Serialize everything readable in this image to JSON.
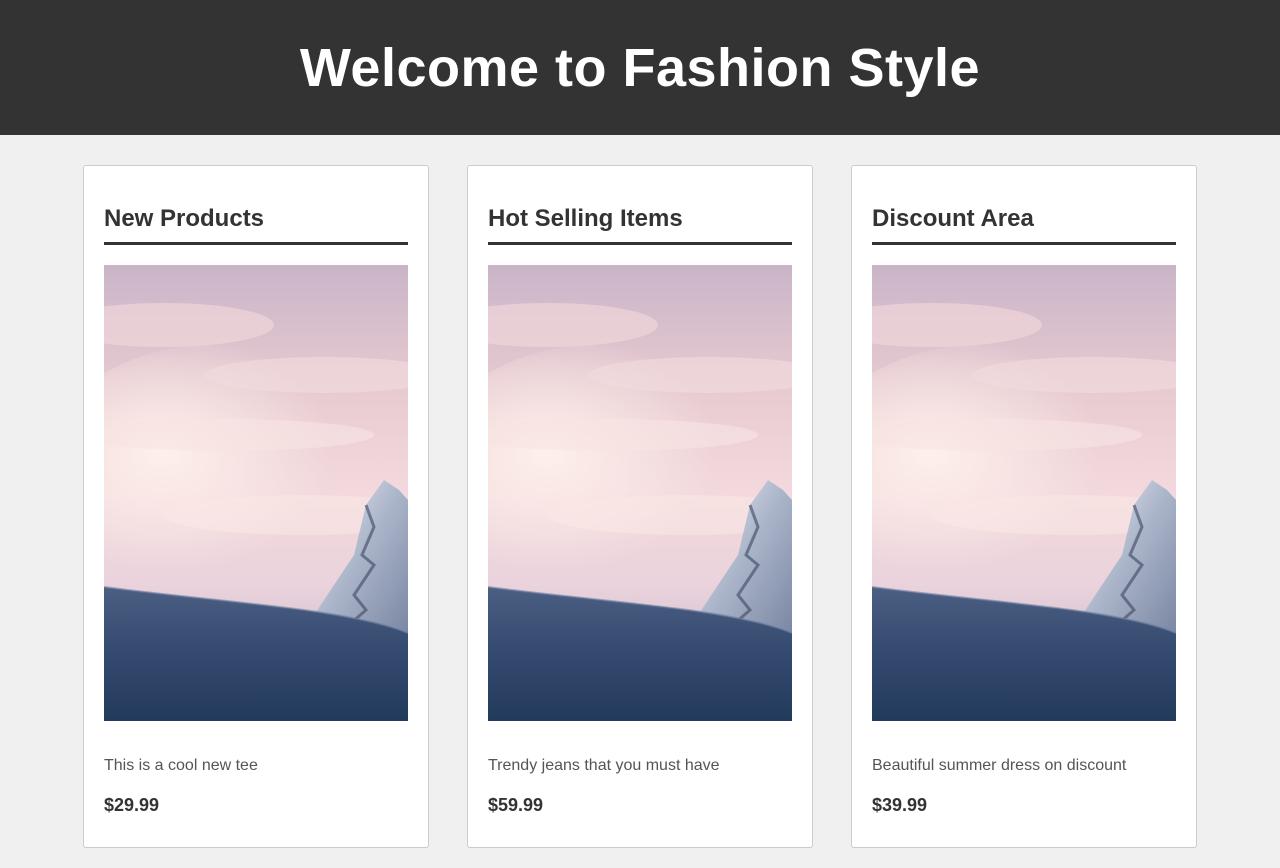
{
  "header": {
    "title": "Welcome to Fashion Style"
  },
  "sections": [
    {
      "title": "New Products",
      "image": "mountain-sunset-photo",
      "description": "This is a cool new tee",
      "price": "$29.99"
    },
    {
      "title": "Hot Selling Items",
      "image": "mountain-sunset-photo",
      "description": "Trendy jeans that you must have",
      "price": "$59.99"
    },
    {
      "title": "Discount Area",
      "image": "mountain-sunset-photo",
      "description": "Beautiful summer dress on discount",
      "price": "$39.99"
    }
  ],
  "colors": {
    "header_bg": "#333333",
    "page_bg": "#f0f0f0",
    "card_bg": "#ffffff"
  }
}
